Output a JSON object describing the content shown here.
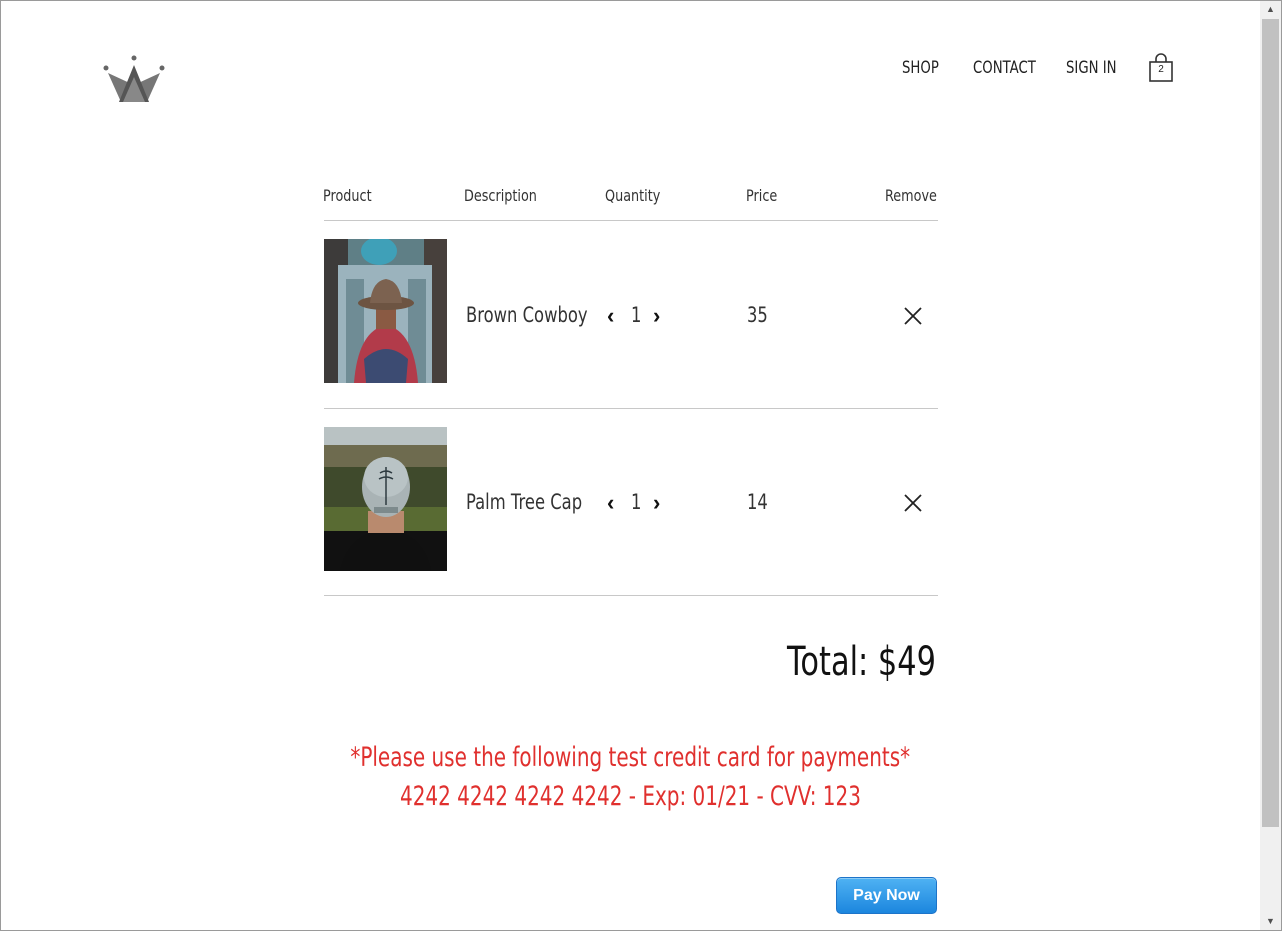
{
  "nav": {
    "shop": "SHOP",
    "contact": "CONTACT",
    "sign_in": "SIGN IN",
    "cart_count": "2",
    "logo_icon": "crown-icon",
    "cart_icon": "shopping-bag-icon"
  },
  "table": {
    "headers": {
      "product": "Product",
      "description": "Description",
      "quantity": "Quantity",
      "price": "Price",
      "remove": "Remove"
    },
    "rows": [
      {
        "description": "Brown Cowboy",
        "quantity": "1",
        "price": "35",
        "image": "man wearing brown cowboy hat and red scarf in front of mosque"
      },
      {
        "description": "Palm Tree Cap",
        "quantity": "1",
        "price": "14",
        "image": "man wearing grey cap with palm tree in park"
      }
    ]
  },
  "total": "Total: $49",
  "notice": {
    "line1": "*Please use the following test credit card for payments*",
    "line2": "4242 4242 4242 4242 - Exp: 01/21 - CVV: 123"
  },
  "pay_button": "Pay Now",
  "colors": {
    "notice_red": "#e0302e",
    "pay_button_blue": "#1c86de",
    "rule_grey": "#c8c8c8"
  }
}
